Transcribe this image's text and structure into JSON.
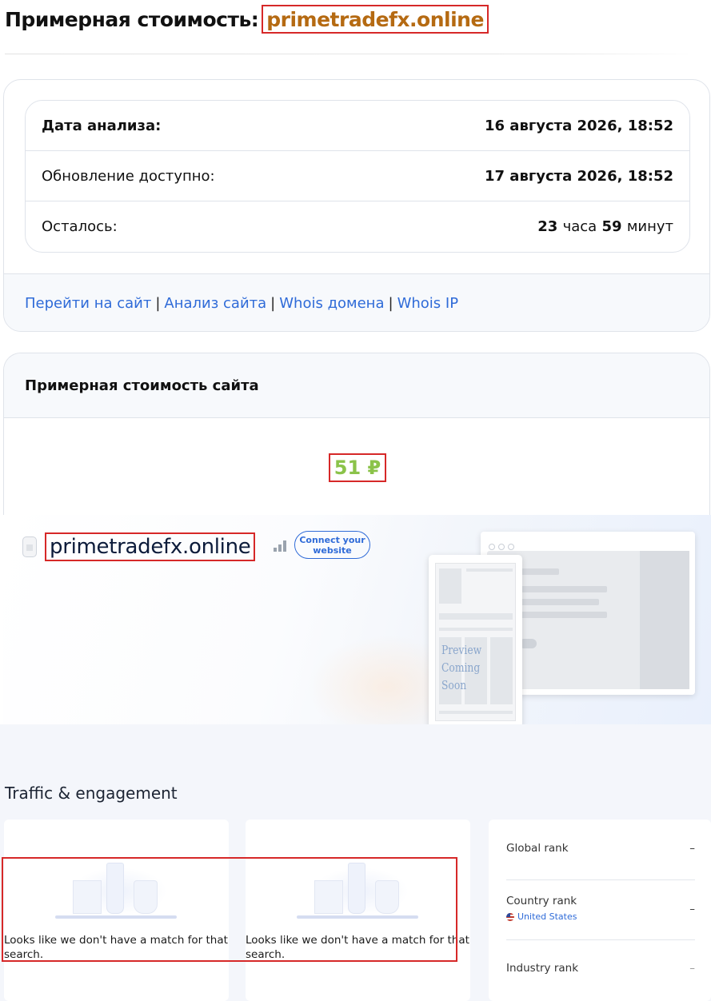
{
  "header": {
    "title_prefix": "Примерная стоимость:",
    "domain": "primetradefx.online"
  },
  "analysis": {
    "rows": [
      {
        "label": "Дата анализа:",
        "value": "16 августа 2026, 18:52"
      },
      {
        "label": "Обновление доступно:",
        "value": "17 августа 2026, 18:52"
      }
    ],
    "remaining": {
      "label": "Осталось:",
      "hours": "23",
      "hours_unit": "часа",
      "minutes": "59",
      "minutes_unit": "минут"
    }
  },
  "links": {
    "visit": "Перейти на сайт",
    "analysis": "Анализ сайта",
    "whois_domain": "Whois домена",
    "whois_ip": "Whois IP",
    "separator": "|"
  },
  "valuation": {
    "heading": "Примерная стоимость сайта",
    "price": "51 ₽",
    "price_color": "#8bc34a"
  },
  "site_preview": {
    "domain": "primetradefx.online",
    "connect_label": "Connect your website",
    "preview_text_line1": "Preview",
    "preview_text_line2": "Coming Soon",
    "icons": [
      "file-icon",
      "signal-icon"
    ]
  },
  "traffic": {
    "title": "Traffic & engagement",
    "empty_message": "Looks like we don't have a match for that search.",
    "ranks": [
      {
        "label": "Global rank",
        "value": "–"
      },
      {
        "label": "Country rank",
        "value": "–",
        "sub": "United States"
      },
      {
        "label": "Industry rank",
        "value": "–"
      }
    ]
  },
  "colors": {
    "accent_link": "#2f6bd8",
    "domain_highlight": "#b56a12",
    "annotation_red": "#d62828"
  }
}
